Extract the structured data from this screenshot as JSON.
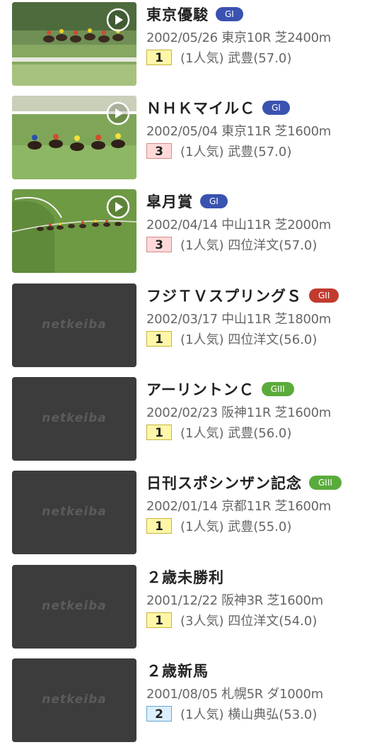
{
  "colors": {
    "g1": "#3a52b0",
    "g2": "#c23b2f",
    "g3": "#5aab3b",
    "rank_1_bg": "#fff7a8",
    "rank_2_bg": "#dbeffc",
    "rank_3_bg": "#ffd9d9"
  },
  "placeholder_logo": "netkeiba",
  "races": [
    {
      "title": "東京優駿",
      "grade": "GI",
      "grade_color": "g1",
      "meta": "2002/05/26 東京10R 芝2400m",
      "rank": "1",
      "detail": "(1人気) 武豊(57.0)",
      "has_video": true
    },
    {
      "title": "ＮＨＫマイルＣ",
      "grade": "GI",
      "grade_color": "g1",
      "meta": "2002/05/04 東京11R 芝1600m",
      "rank": "3",
      "detail": "(1人気) 武豊(57.0)",
      "has_video": true
    },
    {
      "title": "皐月賞",
      "grade": "GI",
      "grade_color": "g1",
      "meta": "2002/04/14 中山11R 芝2000m",
      "rank": "3",
      "detail": "(1人気) 四位洋文(57.0)",
      "has_video": true
    },
    {
      "title": "フジＴＶスプリングＳ",
      "grade": "GII",
      "grade_color": "g2",
      "meta": "2002/03/17 中山11R 芝1800m",
      "rank": "1",
      "detail": "(1人気) 四位洋文(56.0)",
      "has_video": false
    },
    {
      "title": "アーリントンＣ",
      "grade": "GIII",
      "grade_color": "g3",
      "meta": "2002/02/23 阪神11R 芝1600m",
      "rank": "1",
      "detail": "(1人気) 武豊(56.0)",
      "has_video": false
    },
    {
      "title": "日刊スポシンザン記念",
      "grade": "GIII",
      "grade_color": "g3",
      "meta": "2002/01/14 京都11R 芝1600m",
      "rank": "1",
      "detail": "(1人気) 武豊(55.0)",
      "has_video": false
    },
    {
      "title": "２歳未勝利",
      "grade": "",
      "grade_color": "",
      "meta": "2001/12/22 阪神3R 芝1600m",
      "rank": "1",
      "detail": "(3人気) 四位洋文(54.0)",
      "has_video": false
    },
    {
      "title": "２歳新馬",
      "grade": "",
      "grade_color": "",
      "meta": "2001/08/05 札幌5R ダ1000m",
      "rank": "2",
      "detail": "(1人気) 横山典弘(53.0)",
      "has_video": false
    }
  ]
}
